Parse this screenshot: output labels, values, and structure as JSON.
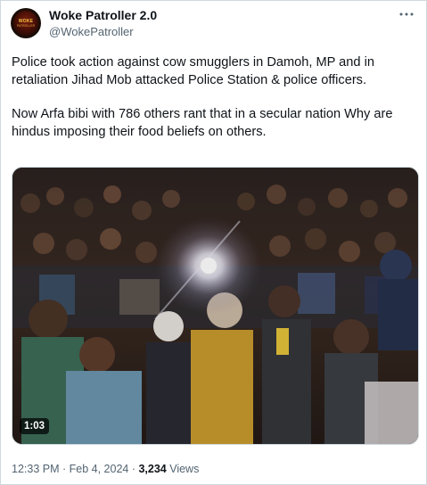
{
  "author": {
    "name": "Woke Patroller 2.0",
    "handle": "@WokePatroller",
    "avatar_text": "WOKE",
    "avatar_subtext": "PATROLLER"
  },
  "more_icon": "more-horizontal-icon",
  "tweet": {
    "paragraph_1": "Police took action against cow smugglers in Damoh, MP and in retaliation Jihad Mob attacked Police Station & police officers.",
    "paragraph_2": "Now Arfa bibi with 786 others rant that in a secular nation Why are hindus imposing their food beliefs on others."
  },
  "video": {
    "duration": "1:03"
  },
  "meta": {
    "time": "12:33 PM",
    "separator_1": " · ",
    "date": "Feb 4, 2024",
    "separator_2": " · ",
    "views_count": "3,234",
    "views_label": " Views"
  },
  "colors": {
    "text_primary": "#0f1419",
    "text_secondary": "#536471",
    "border": "#cfd9de"
  }
}
